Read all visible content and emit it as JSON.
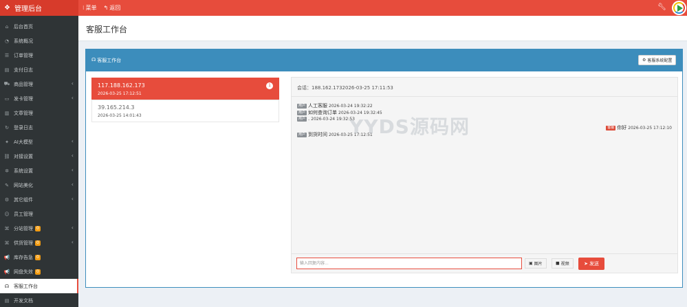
{
  "app": {
    "title": "管理后台",
    "watermark": "YYDS源码网"
  },
  "topnav": {
    "menu": "菜单",
    "back": "返回"
  },
  "sidebar": {
    "items": [
      {
        "label": "后台首页",
        "icon": "home-icon",
        "glyph": "⌂"
      },
      {
        "label": "系统概况",
        "icon": "dashboard-icon",
        "glyph": "◔"
      },
      {
        "label": "订单管理",
        "icon": "list-icon",
        "glyph": "☰"
      },
      {
        "label": "支付日志",
        "icon": "log-icon",
        "glyph": "▤"
      },
      {
        "label": "商品管理",
        "icon": "cart-icon",
        "glyph": "⛟",
        "arrow": true
      },
      {
        "label": "发卡管理",
        "icon": "card-icon",
        "glyph": "▭",
        "arrow": true
      },
      {
        "label": "文章管理",
        "icon": "article-icon",
        "glyph": "▥"
      },
      {
        "label": "登录日志",
        "icon": "history-icon",
        "glyph": "↻"
      },
      {
        "label": "AI大模型",
        "icon": "ai-icon",
        "glyph": "✦",
        "arrow": true
      },
      {
        "label": "对接设置",
        "icon": "link-icon",
        "glyph": "⛓",
        "arrow": true
      },
      {
        "label": "系统设置",
        "icon": "gear-icon",
        "glyph": "✲",
        "arrow": true
      },
      {
        "label": "网站美化",
        "icon": "brush-icon",
        "glyph": "✎",
        "arrow": true
      },
      {
        "label": "其它组件",
        "icon": "cogs-icon",
        "glyph": "⚙",
        "arrow": true
      },
      {
        "label": "员工管理",
        "icon": "user-icon",
        "glyph": "☺"
      },
      {
        "label": "分站管理",
        "icon": "sitemap-icon",
        "glyph": "⌘",
        "badge": "0",
        "arrow": true
      },
      {
        "label": "供货管理",
        "icon": "supply-icon",
        "glyph": "⌘",
        "badge": "0",
        "arrow": true
      },
      {
        "label": "库存告急",
        "icon": "bullhorn-icon",
        "glyph": "📢",
        "badge": "0"
      },
      {
        "label": "网盘失效",
        "icon": "bullhorn-icon",
        "glyph": "📢",
        "badge": "0"
      },
      {
        "label": "客服工作台",
        "icon": "headset-icon",
        "glyph": "☊",
        "active": true
      },
      {
        "label": "开发文档",
        "icon": "doc-icon",
        "glyph": "▤"
      }
    ]
  },
  "page": {
    "title": "客服工作台"
  },
  "panel": {
    "title": "客服工作台",
    "config_button": "客服系统配置"
  },
  "sessions": [
    {
      "ip": "117.188.162.173",
      "time": "2026-03-25 17:12:51",
      "count": "1",
      "active": true
    },
    {
      "ip": "39.165.214.3",
      "time": "2026-03-25 14:01:43",
      "active": false
    }
  ],
  "chat": {
    "title": "会话：188.162.1732026-03-25 17:11:53",
    "messages": [
      {
        "role": "用户",
        "text": "人工客服",
        "time": "2026-03-24 19:32:22",
        "side": "left"
      },
      {
        "role": "用户",
        "text": "如何查询订单",
        "time": "2026-03-24 19:32:45",
        "side": "left"
      },
      {
        "role": "用户",
        "text": ".",
        "time": "2026-03-24 19:32:53",
        "side": "left"
      },
      {
        "role": "客服",
        "text": "你好",
        "time": "2026-03-25 17:12:10",
        "side": "right"
      },
      {
        "role": "用户",
        "text": "到货时间",
        "time": "2026-03-25 17:12:51",
        "side": "left"
      }
    ],
    "input_placeholder": "输入回复内容...",
    "image_button": "图片",
    "video_button": "视频",
    "send_button": "发送"
  },
  "colors": {
    "brand": "#e74c3c",
    "panel": "#3c8dbc",
    "sidebar": "#2f3436"
  }
}
